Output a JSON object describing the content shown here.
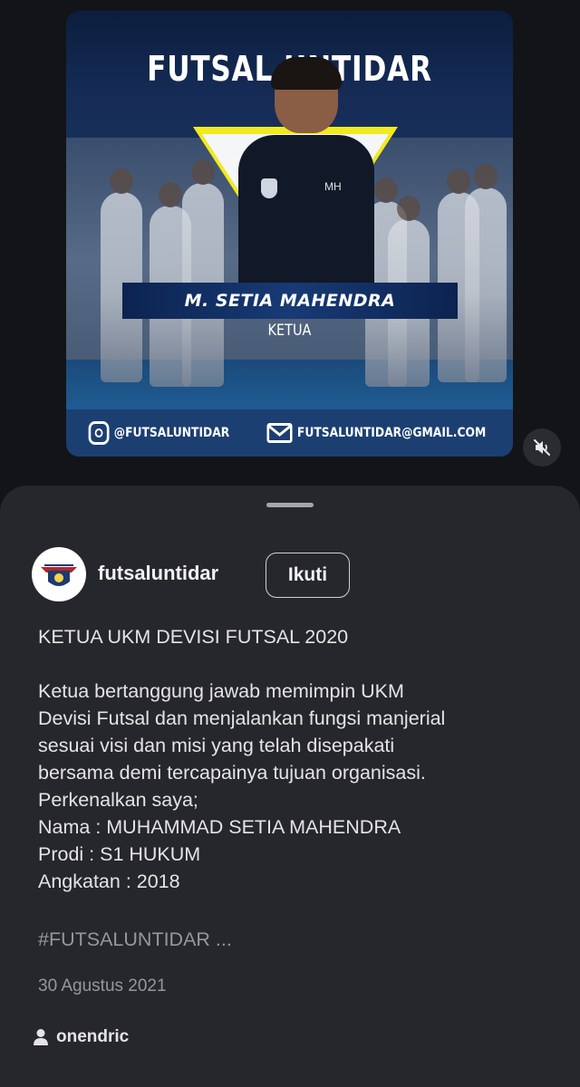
{
  "post_image": {
    "title": "FUTSAL UNTIDAR",
    "name": "M. SETIA MAHENDRA",
    "role": "KETUA",
    "jersey_text": "MH",
    "instagram": "@FUTSALUNTIDAR",
    "email": "FUTSALUNTIDAR@GMAIL.COM"
  },
  "controls": {
    "mute_icon": "muted-speaker-icon"
  },
  "account": {
    "username": "futsaluntidar",
    "follow_label": "Ikuti"
  },
  "caption": {
    "title": "KETUA UKM DEVISI FUTSAL 2020",
    "lines": [
      "Ketua bertanggung jawab memimpin UKM",
      "Devisi Futsal dan menjalankan fungsi manjerial",
      "sesuai visi dan misi yang telah disepakati",
      "bersama demi tercapainya tujuan organisasi.",
      "Perkenalkan saya;",
      "Nama : MUHAMMAD SETIA MAHENDRA",
      "Prodi : S1 HUKUM",
      "Angkatan : 2018"
    ],
    "hashtags": "#FUTSALUNTIDAR ..."
  },
  "date": "30 Agustus 2021",
  "audio_user": "onendric",
  "colors": {
    "background": "#131417",
    "sheet": "#26272c",
    "accent_yellow": "#f1ea1f",
    "banner_blue": "#1c3f71"
  }
}
